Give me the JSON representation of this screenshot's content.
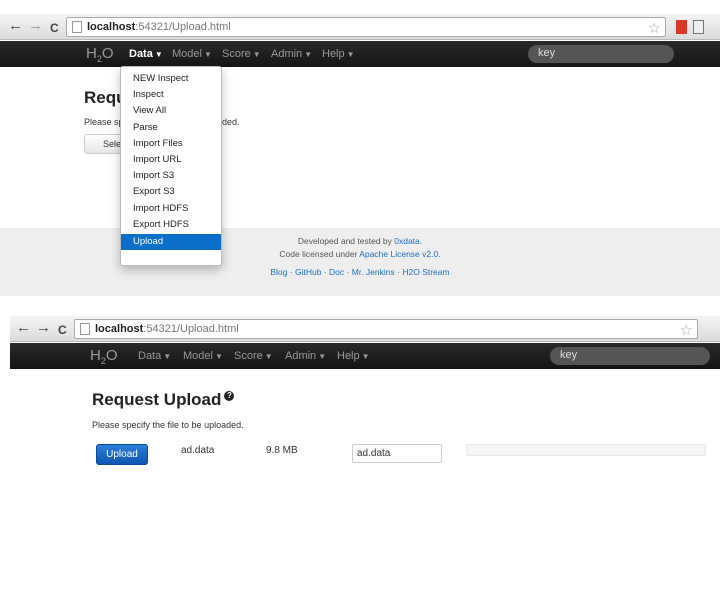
{
  "shot1": {
    "url_host": "localhost",
    "url_rest": ":54321/Upload.html",
    "brand_pre": "H",
    "brand_sub": "2",
    "brand_post": "O",
    "menu": [
      "Data",
      "Model",
      "Score",
      "Admin",
      "Help"
    ],
    "search_placeholder": "key",
    "dropdown": [
      "NEW Inspect",
      "Inspect",
      "View All",
      "Parse",
      "Import Files",
      "Import URL",
      "Import S3",
      "Export S3",
      "Import HDFS",
      "Export HDFS",
      "Upload"
    ],
    "selected": "Upload",
    "heading_partial": "Requ",
    "desc_left": "Please sp",
    "desc_right": "ded.",
    "select_btn_partial": "Sele",
    "footer": {
      "line1_text": "Developed and tested by ",
      "line1_link": "0xdata.",
      "line2_text": "Code licensed under ",
      "line2_link": "Apache License v2.0.",
      "links": [
        "Blog",
        "GitHub",
        "Doc",
        "Mr. Jenkins",
        "H2O Stream"
      ],
      "separator": "·"
    }
  },
  "shot2": {
    "url_host": "localhost",
    "url_rest": ":54321/Upload.html",
    "brand_pre": "H",
    "brand_sub": "2",
    "brand_post": "O",
    "menu": [
      "Data",
      "Model",
      "Score",
      "Admin",
      "Help"
    ],
    "search_placeholder": "key",
    "heading": "Request Upload",
    "help_badge": "?",
    "description": "Please specify the file to be uploaded.",
    "upload_button": "Upload",
    "file_name": "ad.data",
    "file_size": "9.8 MB",
    "input_value": "ad.data",
    "progress_fraction": 0
  },
  "icons": {
    "back": "←",
    "forward": "→",
    "reload": "C",
    "star": "☆"
  },
  "colors": {
    "accent": "#0a6fc9",
    "navbar": "#1b1b1b",
    "link": "#1a6fc1"
  }
}
